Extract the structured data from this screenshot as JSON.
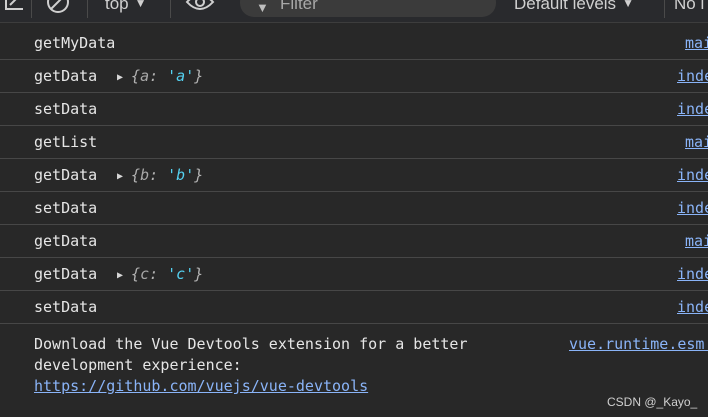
{
  "toolbar": {
    "context": "top",
    "filter_placeholder": "Filter",
    "levels": "Default levels",
    "issues": "No i"
  },
  "rows": [
    {
      "text": "getMyData",
      "source": "mai"
    },
    {
      "text": "getData",
      "source": "inde",
      "obj": {
        "key": "a",
        "value": "'a'"
      }
    },
    {
      "text": "setData",
      "source": "inde"
    },
    {
      "text": "getList",
      "source": "mai"
    },
    {
      "text": "getData",
      "source": "inde",
      "obj": {
        "key": "b",
        "value": "'b'"
      }
    },
    {
      "text": "setData",
      "source": "inde"
    },
    {
      "text": "getData",
      "source": "mai"
    },
    {
      "text": "getData",
      "source": "inde",
      "obj": {
        "key": "c",
        "value": "'c'"
      }
    },
    {
      "text": "setData",
      "source": "inde"
    }
  ],
  "final_message": {
    "line1": "Download the Vue Devtools extension for a better",
    "line2": "development experience:",
    "link": "https://github.com/vuejs/vue-devtools",
    "source": "vue.runtime.esm."
  },
  "watermark": "CSDN @_Kayo_",
  "colors": {
    "background": "#282828",
    "link": "#8ab4f8",
    "string_value": "#54d1f0"
  },
  "icons": [
    "clear-console-icon",
    "block-icon",
    "eye-icon",
    "filter-icon",
    "expand-triangle-icon"
  ]
}
